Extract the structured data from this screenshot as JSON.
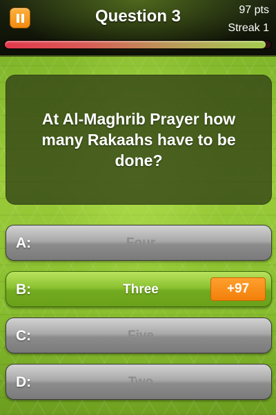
{
  "header": {
    "title": "Question 3",
    "points": "97 pts",
    "streak": "Streak 1",
    "timer_fraction": 0.98,
    "pause_icon": "pause-icon"
  },
  "question": {
    "text": "At Al-Maghrib Prayer how many Rakaahs have to be done?"
  },
  "answers": [
    {
      "letter": "A:",
      "text": "Four",
      "state": "disabled"
    },
    {
      "letter": "B:",
      "text": "Three",
      "state": "correct",
      "badge": "+97"
    },
    {
      "letter": "C:",
      "text": "Five",
      "state": "disabled"
    },
    {
      "letter": "D:",
      "text": "Two",
      "state": "disabled"
    }
  ],
  "colors": {
    "accent": "#f28a12",
    "correct": "#8cc232",
    "disabled_text": "#8c8c8c"
  }
}
